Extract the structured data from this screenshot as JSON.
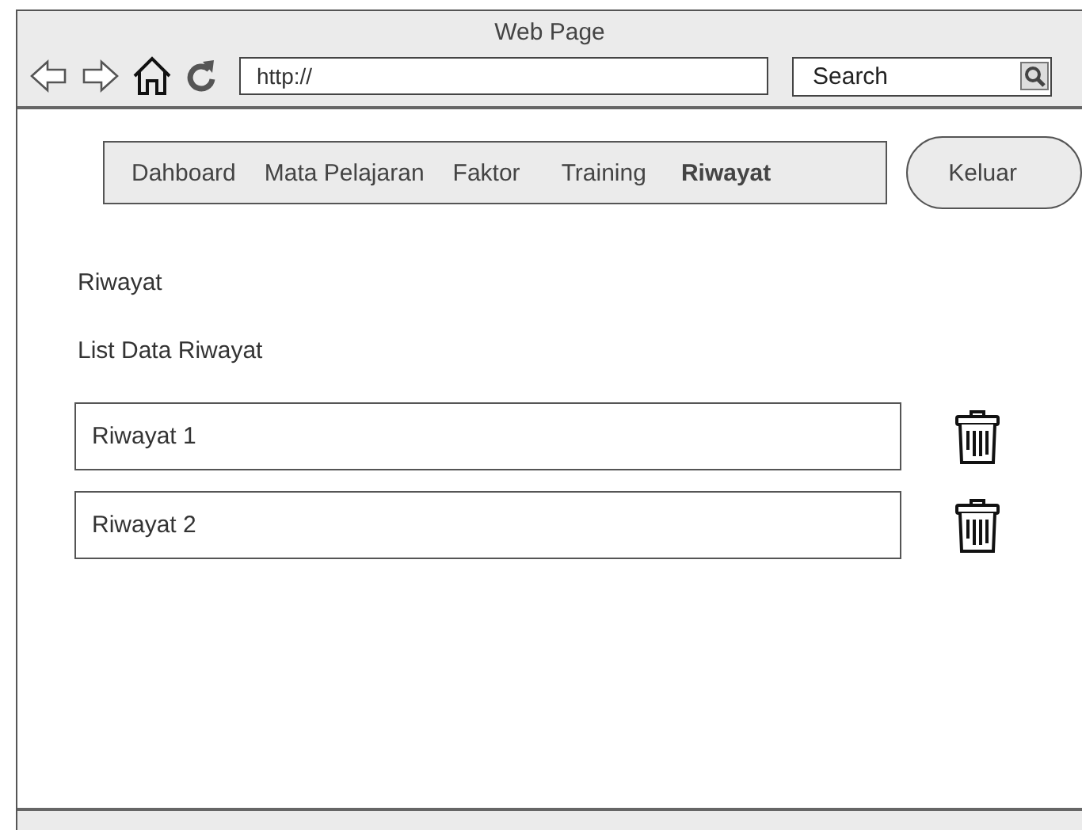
{
  "window": {
    "title": "Web Page",
    "url": "http://",
    "search_placeholder": "Search"
  },
  "nav": [
    {
      "label": "Dahboard",
      "selected": false
    },
    {
      "label": "Mata Pelajaran",
      "selected": false
    },
    {
      "label": "Faktor",
      "selected": false
    },
    {
      "label": "Training",
      "selected": false
    },
    {
      "label": "Riwayat",
      "selected": true
    }
  ],
  "logout_button": "Keluar",
  "heading": "Riwayat",
  "list_title": "List Data Riwayat",
  "rows": [
    {
      "name": "Riwayat 1"
    },
    {
      "name": "Riwayat 2"
    }
  ]
}
